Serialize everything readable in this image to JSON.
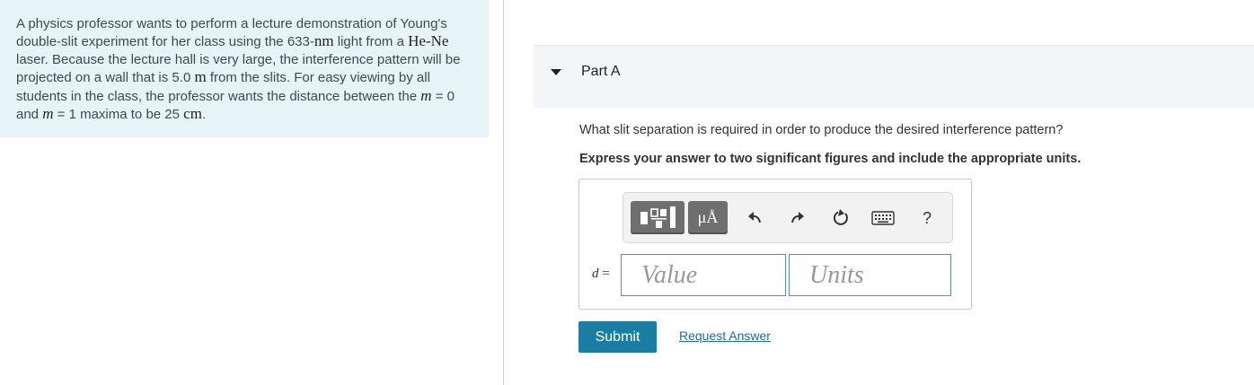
{
  "problem": {
    "t1": "A physics professor wants to perform a lecture demonstration of Young's double-slit experiment for her class using the 633-",
    "u_nm": "nm",
    "t2": " light from a ",
    "he_ne": "He-Ne",
    "t3": " laser. Because the lecture hall is very large, the interference pattern will be projected on a wall that is 5.0 ",
    "u_m": "m",
    "t4": " from the slits. For easy viewing by all students in the class, the professor wants the distance between the ",
    "m1": "m",
    "t5": " = 0 and ",
    "m2": "m",
    "t6": " = 1 maxima to be 25 ",
    "u_cm": "cm",
    "t7": "."
  },
  "part": {
    "title": "Part A"
  },
  "question": "What slit separation is required in order to produce the desired interference pattern?",
  "instruction": "Express your answer to two significant figures and include the appropriate units.",
  "toolbar": {
    "units_label": "μÅ",
    "icons": [
      "templates-icon",
      "units-icon",
      "undo-icon",
      "redo-icon",
      "reset-icon",
      "keyboard-icon",
      "help-icon"
    ],
    "help_label": "?"
  },
  "answer": {
    "variable": "d",
    "equals": " =",
    "value_placeholder": "Value",
    "units_placeholder": "Units"
  },
  "actions": {
    "submit": "Submit",
    "request_answer": "Request Answer"
  },
  "colors": {
    "problem_bg": "#e6f4f7",
    "submit_bg": "#1a7ea4",
    "link": "#1a6fa1"
  }
}
